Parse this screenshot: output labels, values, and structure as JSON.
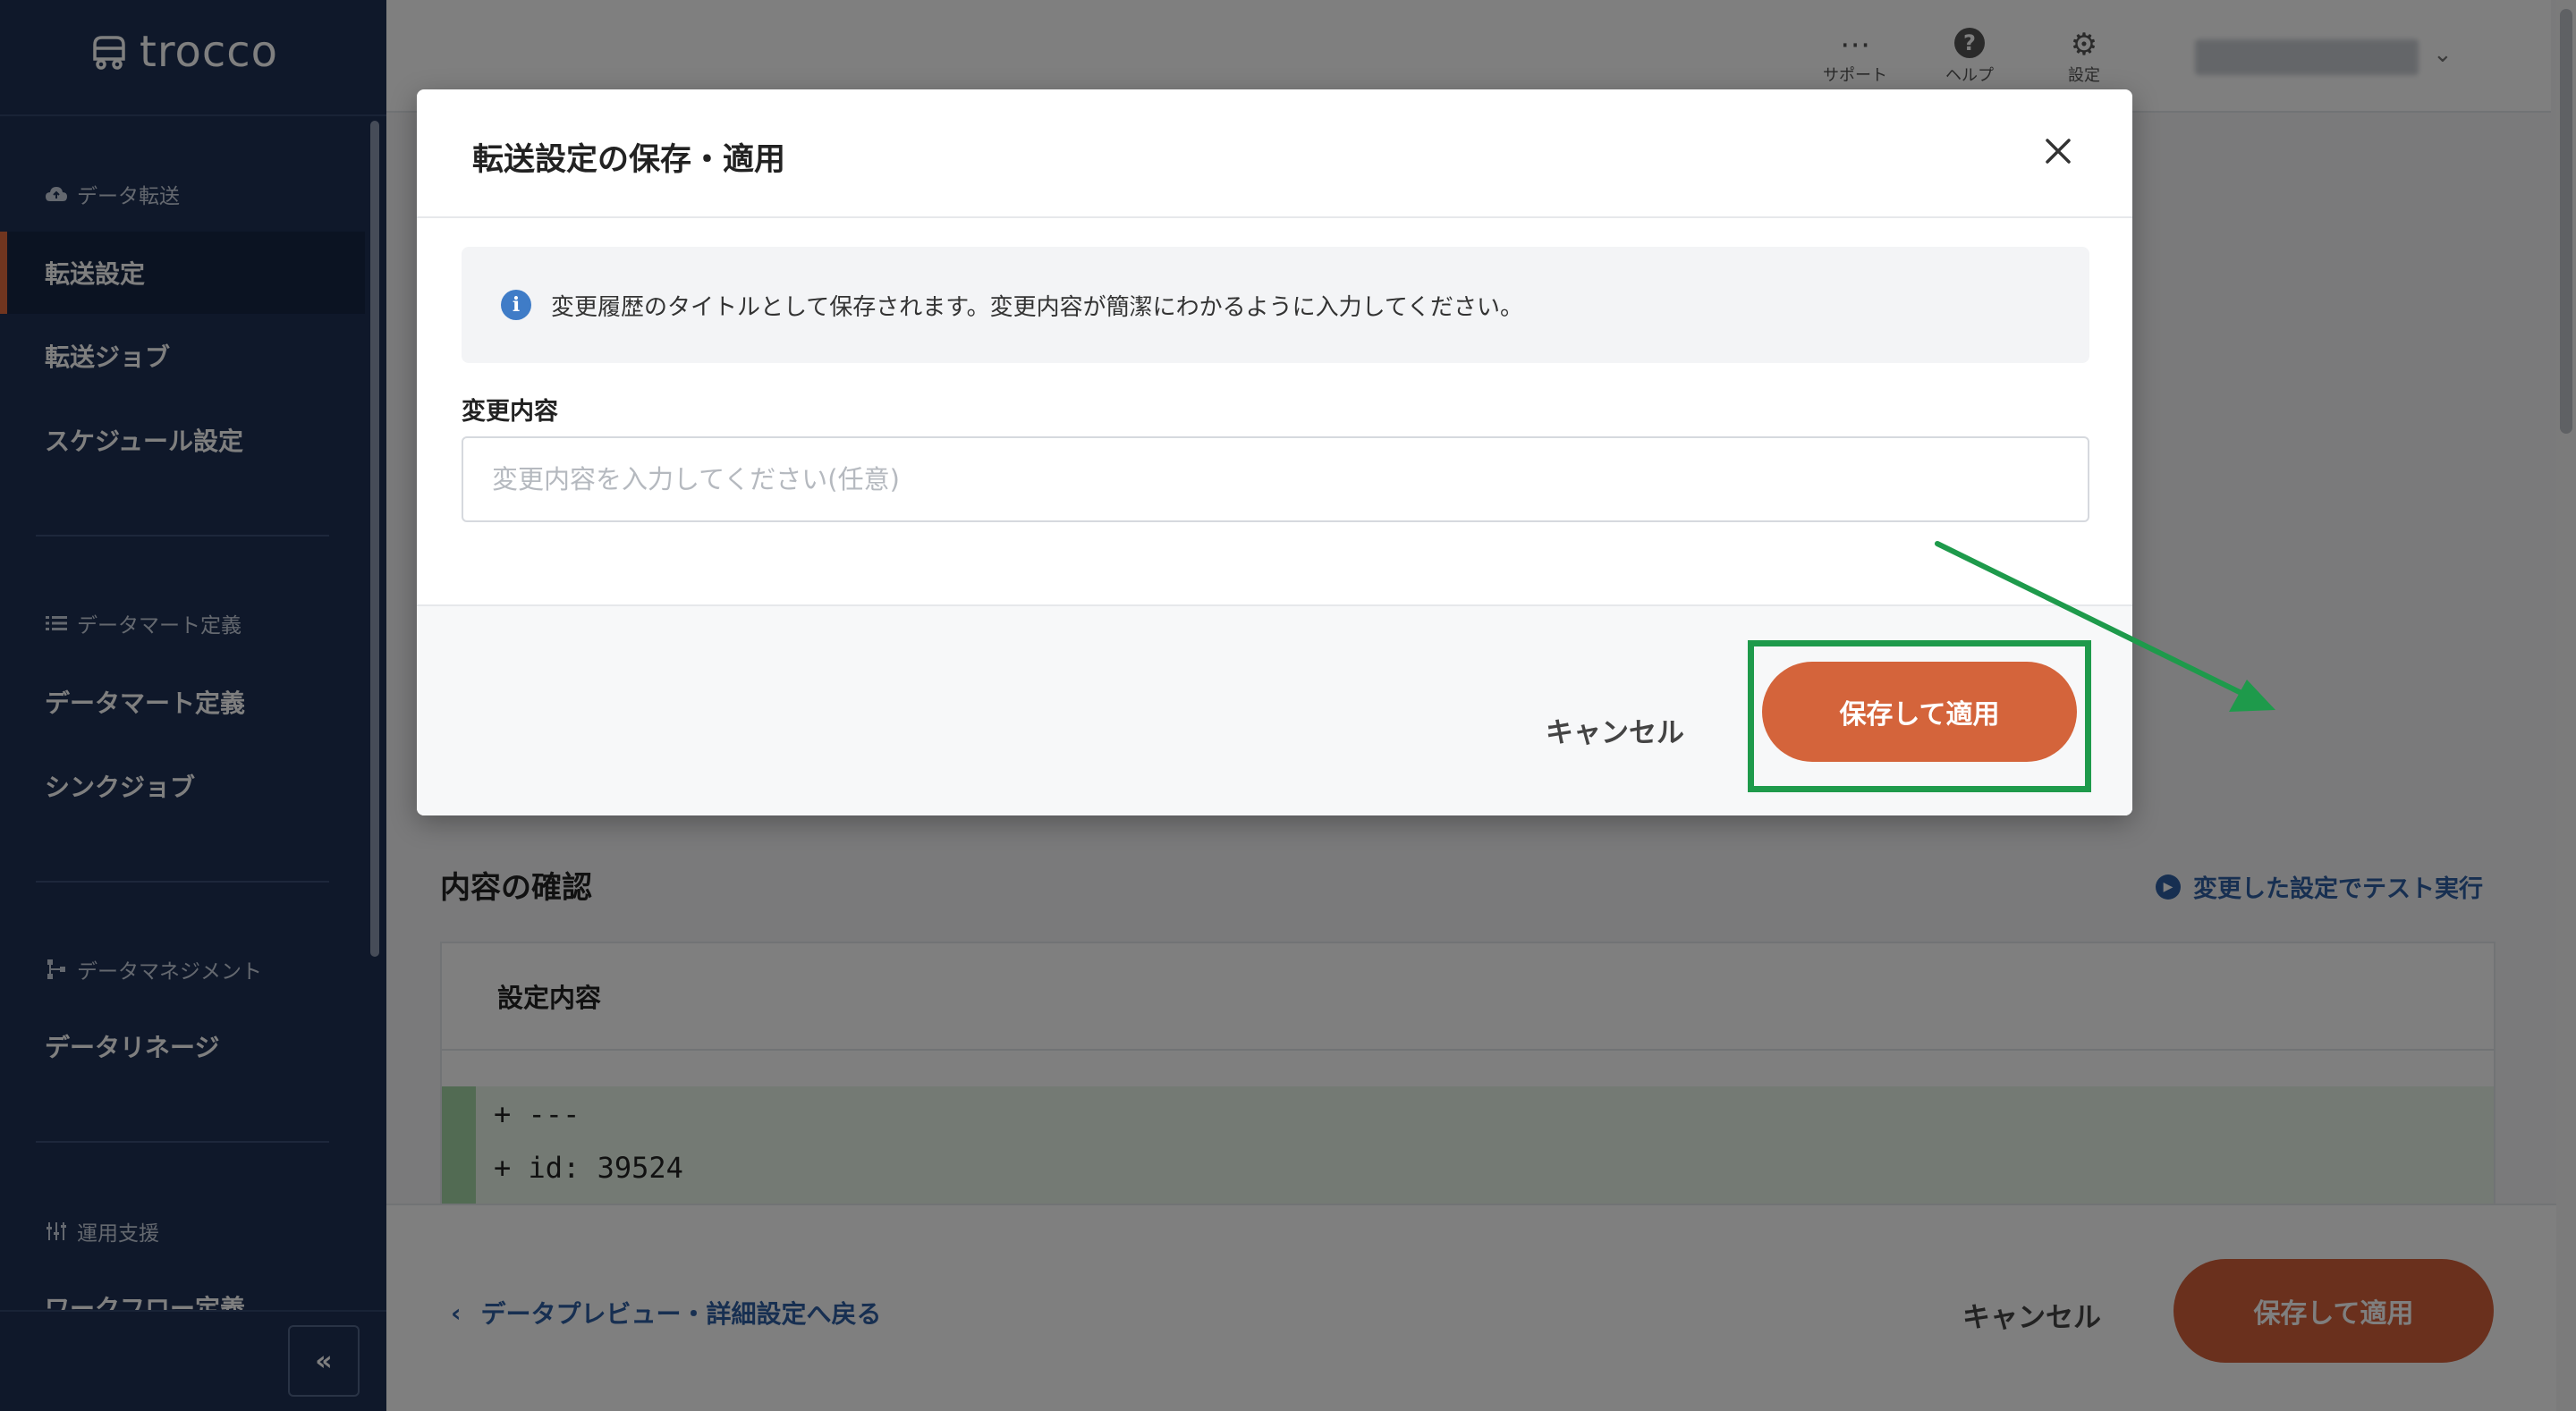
{
  "app": {
    "logo_text": "trocco"
  },
  "sidebar": {
    "sections": [
      {
        "heading": "データ転送",
        "icon": "cloud-upload-icon",
        "items": [
          "転送設定",
          "転送ジョブ",
          "スケジュール設定"
        ]
      },
      {
        "heading": "データマート定義",
        "icon": "list-icon",
        "items": [
          "データマート定義",
          "シンクジョブ"
        ]
      },
      {
        "heading": "データマネジメント",
        "icon": "lineage-icon",
        "items": [
          "データリネージ"
        ]
      },
      {
        "heading": "運用支援",
        "icon": "sliders-icon",
        "items": [
          "ワークフロー定義"
        ]
      }
    ],
    "active_item": "転送設定",
    "collapse_label": "«"
  },
  "topbar": {
    "support_label": "サポート",
    "help_label": "ヘルプ",
    "settings_label": "設定"
  },
  "page": {
    "confirm_title": "内容の確認",
    "test_link": "変更した設定でテスト実行",
    "settings_heading": "設定内容",
    "diff_lines": [
      "+ ---",
      "+ id: 39524"
    ]
  },
  "footer": {
    "back_link": "データプレビュー・詳細設定へ戻る",
    "cancel_label": "キャンセル",
    "save_label": "保存して適用"
  },
  "modal": {
    "title": "転送設定の保存・適用",
    "info_text": "変更履歴のタイトルとして保存されます。変更内容が簡潔にわかるように入力してください。",
    "field_label": "変更内容",
    "field_placeholder": "変更内容を入力してください(任意)",
    "field_value": "",
    "cancel_label": "キャンセル",
    "save_label": "保存して適用"
  },
  "colors": {
    "sidebar_bg": "#1e3055",
    "accent_orange": "#d4643b",
    "link_blue": "#2f5fa3",
    "highlight_green": "#1e9a4b"
  }
}
